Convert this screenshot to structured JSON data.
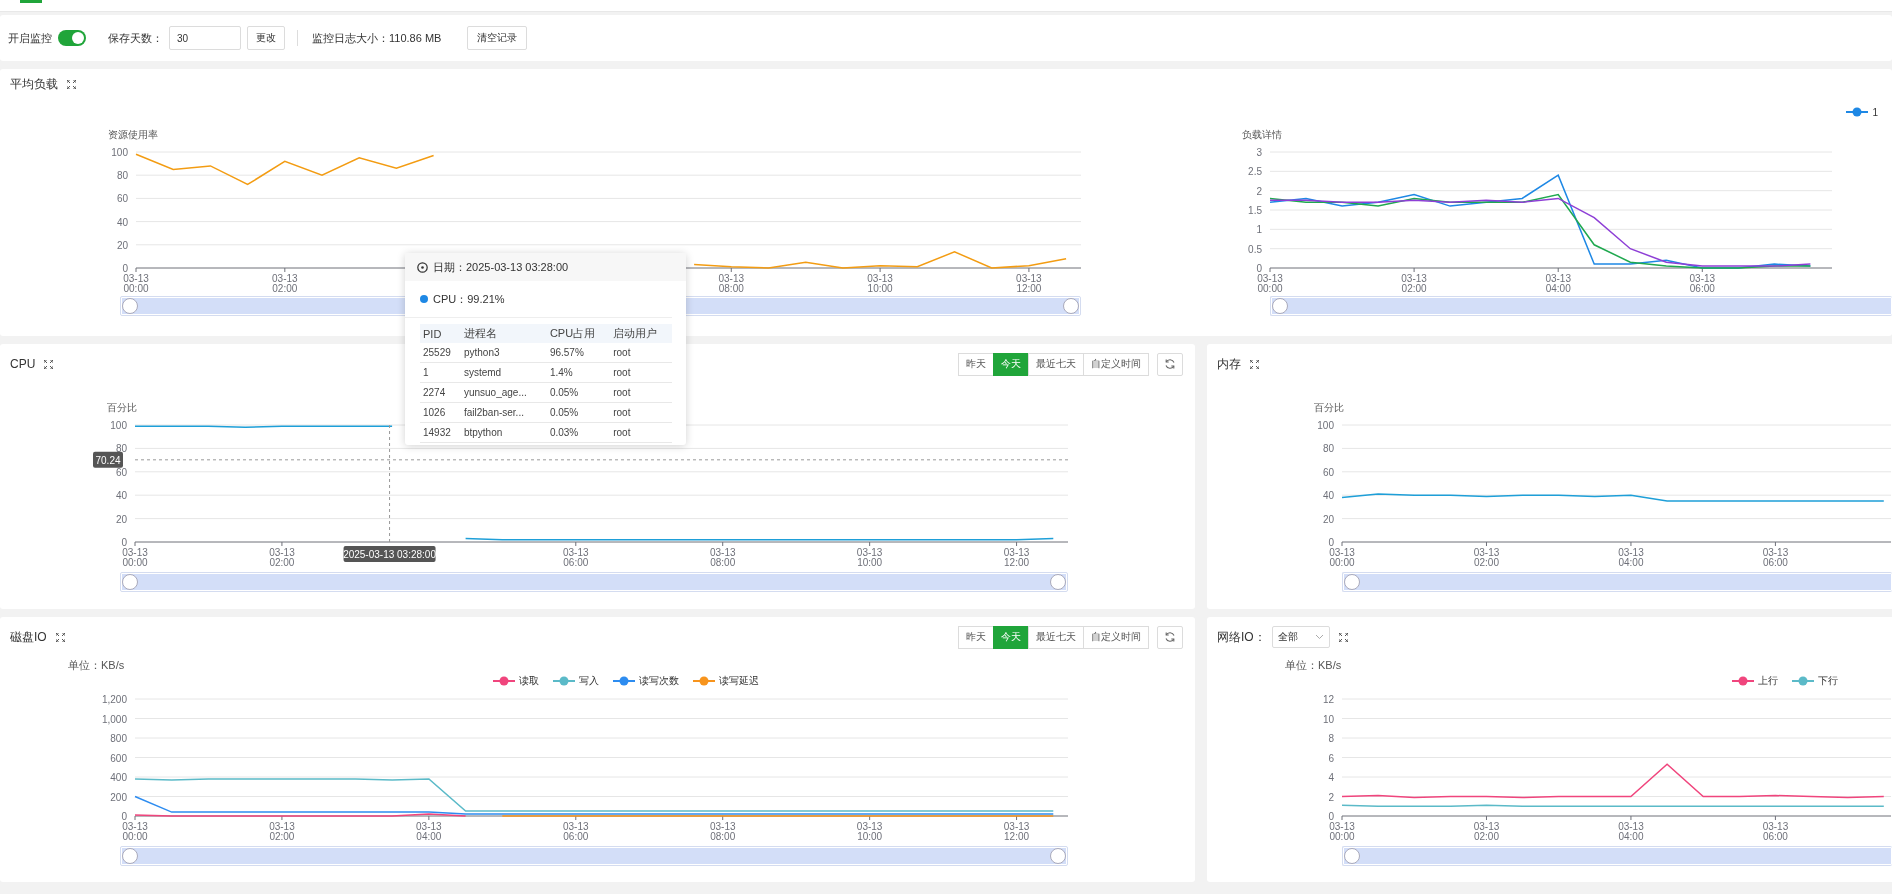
{
  "monitor_bar": {
    "enable_label": "开启监控",
    "enabled": true,
    "retention_label": "保存天数：",
    "retention_value": "30",
    "change_button": "更改",
    "log_size": "监控日志大小：110.86 MB",
    "clear_button": "清空记录"
  },
  "load": {
    "title": "平均负载",
    "usage_chart": {
      "slider": {
        "level": 1
      },
      "chart_data": {
        "type": "line",
        "grid": true,
        "ylabel": "资源使用率",
        "categories": [
          "03-13 00:00",
          null,
          null,
          null,
          "03-13 02:00",
          null,
          null,
          null,
          null,
          null,
          null,
          null,
          null,
          null,
          null,
          null,
          "03-13 08:00",
          null,
          null,
          null,
          "03-13 10:00",
          null,
          null,
          null,
          "03-13 12:00",
          null
        ],
        "ylim": [
          0,
          100
        ],
        "yticks": [
          0,
          20,
          40,
          60,
          80,
          100
        ],
        "series": [
          {
            "name": null,
            "color": "#f39c12",
            "values": [
              98,
              85,
              88,
              72,
              92,
              80,
              95,
              86,
              97,
              null,
              null,
              null,
              null,
              null,
              null,
              3,
              1,
              0,
              5,
              0,
              2,
              1,
              14,
              0,
              2,
              8
            ]
          }
        ]
      }
    },
    "detail_chart": {
      "slider": {
        "level": 1
      },
      "chart_data": {
        "type": "line",
        "grid": true,
        "ylabel": "负载详情",
        "categories": [
          "03-13 00:00",
          null,
          null,
          null,
          "03-13 02:00",
          null,
          null,
          null,
          "03-13 04:00",
          null,
          null,
          null,
          "03-13 06:00",
          null,
          null,
          null
        ],
        "ylim": [
          0,
          3
        ],
        "yticks": [
          0,
          {
            "value": 0.5,
            "label": "0.5"
          },
          1,
          {
            "value": 1.5,
            "label": "1.5"
          },
          2,
          {
            "value": 2.5,
            "label": "2.5"
          },
          3
        ],
        "series": [
          {
            "name": "1",
            "color": "#1e88e5",
            "values": [
              1.7,
              1.8,
              1.6,
              1.7,
              1.9,
              1.6,
              1.7,
              1.8,
              2.4,
              0.1,
              0.1,
              0.2,
              0,
              0,
              0.1,
              0.05
            ]
          },
          {
            "name": null,
            "color": "#1fa84f",
            "values": [
              1.8,
              1.7,
              1.7,
              1.6,
              1.8,
              1.7,
              1.7,
              1.7,
              1.9,
              0.6,
              0.15,
              0.05,
              0,
              0,
              0.05,
              0.05
            ]
          },
          {
            "name": null,
            "color": "#8e3fd6",
            "values": [
              1.75,
              1.75,
              1.7,
              1.7,
              1.75,
              1.7,
              1.75,
              1.7,
              1.8,
              1.3,
              0.5,
              0.15,
              0.05,
              0.05,
              0.05,
              0.1
            ]
          }
        ]
      }
    }
  },
  "cpu": {
    "title": "CPU",
    "ranges": [
      {
        "label": "昨天",
        "selected": false
      },
      {
        "label": "今天",
        "selected": true
      },
      {
        "label": "最近七天",
        "selected": false
      },
      {
        "label": "自定义时间",
        "selected": false
      }
    ],
    "slider": {
      "level": 1
    },
    "chart_data": {
      "type": "line",
      "grid": true,
      "ylabel": "百分比",
      "categories": [
        "03-13 00:00",
        null,
        null,
        null,
        "03-13 02:00",
        null,
        null,
        null,
        null,
        null,
        null,
        null,
        "03-13 06:00",
        null,
        null,
        null,
        "03-13 08:00",
        null,
        null,
        null,
        "03-13 10:00",
        null,
        null,
        null,
        "03-13 12:00",
        null
      ],
      "ylim": [
        0,
        100
      ],
      "yticks": [
        0,
        20,
        40,
        60,
        80,
        100
      ],
      "series": [
        {
          "name": null,
          "color": "#1e9fd8",
          "values": [
            99,
            99,
            99,
            98,
            99,
            99,
            99,
            99,
            null,
            3,
            2,
            2,
            2,
            2,
            2,
            2,
            2,
            2,
            2,
            2,
            2,
            2,
            2,
            2,
            2,
            3
          ]
        }
      ],
      "annotations": [
        "2025-03-13 03:28:00"
      ],
      "ref_lines": [
        {
          "axis": "y",
          "value": 70.24,
          "label": "70.24"
        }
      ]
    }
  },
  "memory": {
    "title": "内存",
    "slider": {
      "level": 1
    },
    "chart_data": {
      "type": "line",
      "grid": true,
      "ylabel": "百分比",
      "categories": [
        "03-13 00:00",
        null,
        null,
        null,
        "03-13 02:00",
        null,
        null,
        null,
        "03-13 04:00",
        null,
        null,
        null,
        "03-13 06:00",
        null,
        null,
        null
      ],
      "ylim": [
        0,
        100
      ],
      "yticks": [
        0,
        20,
        40,
        60,
        80,
        100
      ],
      "series": [
        {
          "name": null,
          "color": "#1e9fd8",
          "values": [
            38,
            41,
            40,
            40,
            39,
            40,
            40,
            39,
            40,
            35,
            35,
            35,
            35,
            35,
            35,
            35
          ]
        }
      ]
    }
  },
  "disk_io": {
    "title": "磁盘IO",
    "ranges": [
      {
        "label": "昨天",
        "selected": false
      },
      {
        "label": "今天",
        "selected": true
      },
      {
        "label": "最近七天",
        "selected": false
      },
      {
        "label": "自定义时间",
        "selected": false
      }
    ],
    "unit": "单位：KB/s",
    "slider": {
      "level": 1
    },
    "chart_data": {
      "type": "line",
      "grid": true,
      "categories": [
        "03-13 00:00",
        null,
        null,
        null,
        "03-13 02:00",
        null,
        null,
        null,
        "03-13 04:00",
        null,
        null,
        null,
        "03-13 06:00",
        null,
        null,
        null,
        "03-13 08:00",
        null,
        null,
        null,
        "03-13 10:00",
        null,
        null,
        null,
        "03-13 12:00",
        null
      ],
      "ylim": [
        0,
        1200
      ],
      "yticks": [
        0,
        200,
        400,
        600,
        800,
        {
          "value": 1000,
          "label": "1,000"
        },
        {
          "value": 1200,
          "label": "1,200"
        }
      ],
      "series": [
        {
          "name": "读取",
          "color": "#f0457d",
          "values": [
            10,
            0,
            0,
            0,
            0,
            0,
            0,
            0,
            20,
            0,
            null,
            null,
            null,
            null,
            null,
            null,
            null,
            null,
            null,
            null,
            null,
            null,
            null,
            null,
            null,
            null
          ]
        },
        {
          "name": "写入",
          "color": "#5bbac8",
          "values": [
            380,
            370,
            380,
            380,
            380,
            380,
            380,
            370,
            380,
            50,
            50,
            50,
            50,
            50,
            50,
            50,
            50,
            50,
            50,
            50,
            50,
            50,
            50,
            50,
            50,
            50
          ]
        },
        {
          "name": "读写次数",
          "color": "#2d8cf0",
          "values": [
            200,
            40,
            40,
            40,
            40,
            40,
            40,
            40,
            40,
            20,
            20,
            20,
            20,
            20,
            20,
            20,
            20,
            20,
            20,
            20,
            20,
            20,
            20,
            20,
            20,
            20
          ]
        },
        {
          "name": "读写延迟",
          "color": "#f7941d",
          "values": [
            null,
            null,
            null,
            null,
            null,
            null,
            null,
            null,
            null,
            null,
            0,
            0,
            0,
            0,
            0,
            0,
            0,
            0,
            0,
            0,
            0,
            0,
            0,
            0,
            0,
            0
          ]
        }
      ]
    }
  },
  "network_io": {
    "title": "网络IO：",
    "interface": "全部",
    "unit": "单位：KB/s",
    "slider": {
      "level": 1
    },
    "chart_data": {
      "type": "line",
      "grid": true,
      "categories": [
        "03-13 00:00",
        null,
        null,
        null,
        "03-13 02:00",
        null,
        null,
        null,
        "03-13 04:00",
        null,
        null,
        null,
        "03-13 06:00",
        null,
        null,
        null
      ],
      "ylim": [
        0,
        12
      ],
      "yticks": [
        0,
        2,
        4,
        6,
        8,
        10,
        12
      ],
      "series": [
        {
          "name": "上行",
          "color": "#f0457d",
          "values": [
            2,
            2.1,
            1.9,
            2,
            2,
            1.9,
            2,
            2,
            2,
            5.3,
            2,
            2,
            2.1,
            2,
            1.9,
            2
          ]
        },
        {
          "name": "下行",
          "color": "#5bbac8",
          "values": [
            1.1,
            1,
            1,
            1,
            1.1,
            1,
            1,
            1,
            1,
            1,
            1,
            1,
            1,
            1,
            1,
            1
          ]
        }
      ]
    }
  },
  "tooltip": {
    "date": "日期：2025-03-13 03:28:00",
    "series_label": "CPU：99.21%",
    "columns": [
      "PID",
      "进程名",
      "CPU占用",
      "启动用户"
    ],
    "rows": [
      [
        "25529",
        "python3",
        "96.57%",
        "root"
      ],
      [
        "1",
        "systemd",
        "1.4%",
        "root"
      ],
      [
        "2274",
        "yunsuo_age...",
        "0.05%",
        "root"
      ],
      [
        "1026",
        "fail2ban-ser...",
        "0.05%",
        "root"
      ],
      [
        "14932",
        "btpython",
        "0.03%",
        "root"
      ]
    ]
  }
}
